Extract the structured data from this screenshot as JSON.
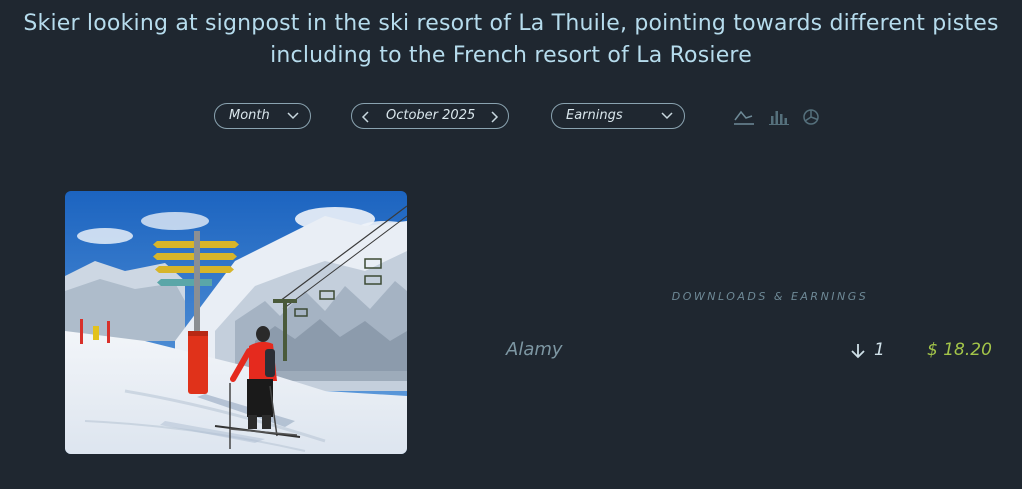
{
  "title": "Skier looking at signpost in the ski resort of La Thuile, pointing towards different pistes including to the French resort of La Rosiere",
  "controls": {
    "period_type": "Month",
    "period_value": "October 2025",
    "metric": "Earnings",
    "chart_types": [
      "line-chart-icon",
      "bar-chart-icon",
      "pie-chart-icon"
    ],
    "active_chart": "line"
  },
  "stats": {
    "heading": "DOWNLOADS & EARNINGS",
    "rows": [
      {
        "source": "Alamy",
        "downloads": "1",
        "earnings": "$ 18.20"
      }
    ]
  },
  "colors": {
    "background": "#1f2730",
    "title": "#b6dced",
    "earnings": "#a3c549"
  }
}
